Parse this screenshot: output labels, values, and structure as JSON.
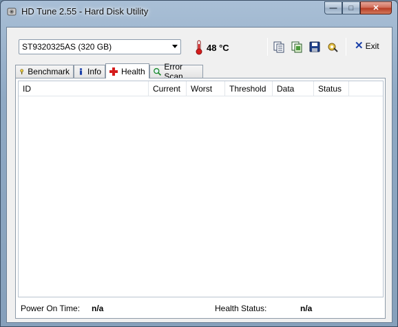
{
  "window": {
    "title": "HD Tune 2.55 - Hard Disk Utility",
    "controls": {
      "minimize": "—",
      "maximize": "□",
      "close": "✕"
    }
  },
  "toolbar": {
    "drive": "ST9320325AS (320 GB)",
    "temperature": "48 °C",
    "icons": [
      "copy-text-icon",
      "copy-screenshot-icon",
      "save-icon",
      "options-icon"
    ],
    "exit_label": "Exit"
  },
  "tabs": [
    {
      "label": "Benchmark",
      "icon": "benchmark-icon"
    },
    {
      "label": "Info",
      "icon": "info-icon"
    },
    {
      "label": "Health",
      "icon": "health-cross-icon",
      "active": true
    },
    {
      "label": "Error Scan",
      "icon": "magnifier-icon"
    }
  ],
  "health": {
    "columns": [
      "ID",
      "Current",
      "Worst",
      "Threshold",
      "Data",
      "Status"
    ],
    "rows": [],
    "power_on_time_label": "Power On Time:",
    "power_on_time_value": "n/a",
    "health_status_label": "Health Status:",
    "health_status_value": "n/a"
  },
  "colors": {
    "frame": "#8fa9c4",
    "close_button": "#c74a30",
    "client_bg": "#f0f0f0"
  }
}
